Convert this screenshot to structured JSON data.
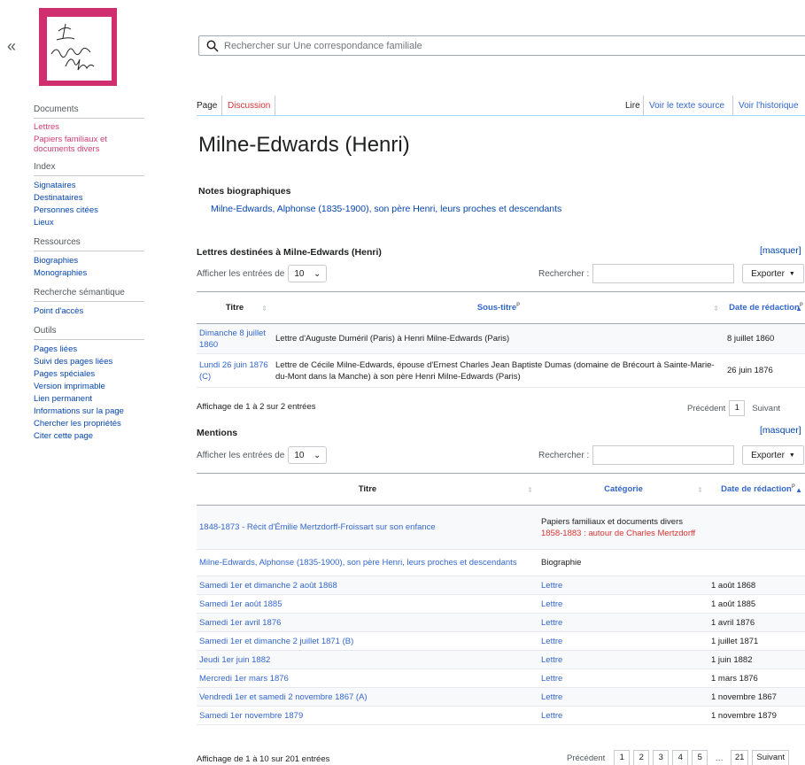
{
  "nav": {
    "collapse_glyph": "«"
  },
  "logo": {
    "alt_icon": "manuscript-logo"
  },
  "search": {
    "placeholder": "Rechercher sur Une correspondance familiale"
  },
  "sidebar": {
    "documents": {
      "heading": "Documents",
      "items": [
        "Lettres",
        "Papiers familiaux et documents divers"
      ]
    },
    "index": {
      "heading": "Index",
      "items": [
        "Signataires",
        "Destinataires",
        "Personnes citées",
        "Lieux"
      ]
    },
    "ressources": {
      "heading": "Ressources",
      "items": [
        "Biographies",
        "Monographies"
      ]
    },
    "semantique": {
      "heading": "Recherche sémantique",
      "items": [
        "Point d'accès"
      ]
    },
    "outils": {
      "heading": "Outils",
      "items": [
        "Pages liées",
        "Suivi des pages liées",
        "Pages spéciales",
        "Version imprimable",
        "Lien permanent",
        "Informations sur la page",
        "Chercher les propriétés",
        "Citer cette page"
      ]
    }
  },
  "tabs": {
    "page": "Page",
    "discussion": "Discussion",
    "lire": "Lire",
    "source": "Voir le texte source",
    "historique": "Voir l'historique"
  },
  "page": {
    "title": "Milne-Edwards (Henri)"
  },
  "notes": {
    "heading": "Notes biographiques",
    "link": "Milne-Edwards, Alphonse (1835-1900), son père Henri, leurs proches et descendants"
  },
  "letters": {
    "heading": "Lettres destinées à Milne-Edwards (Henri)",
    "masquer": "[masquer]",
    "show_label": "Afficher les entrées de",
    "show_value": "10",
    "search_label": "Rechercher :",
    "export_label": "Exporter",
    "columns": [
      "Titre",
      "Sous-titre",
      "Date de rédaction"
    ],
    "p_marker": "P",
    "rows": [
      {
        "title": "Dimanche 8 juillet 1860",
        "subtitle": "Lettre d'Auguste Duméril (Paris) à Henri Milne-Edwards (Paris)",
        "date": "8 juillet 1860"
      },
      {
        "title": "Lundi 26 juin 1876 (C)",
        "subtitle": "Lettre de Cécile Milne-Edwards, épouse d'Ernest Charles Jean Baptiste Dumas (domaine de Brécourt à Sainte-Marie-du-Mont dans la Manche) à son père Henri Milne-Edwards (Paris)",
        "date": "26 juin 1876"
      }
    ],
    "info": "Affichage de 1 à 2 sur 2 entrées",
    "prev": "Précédent",
    "next": "Suivant",
    "pages": [
      "1"
    ]
  },
  "mentions": {
    "heading": "Mentions",
    "masquer": "[masquer]",
    "show_label": "Afficher les entrées de",
    "show_value": "10",
    "search_label": "Rechercher :",
    "export_label": "Exporter",
    "columns": [
      "Titre",
      "Catégorie",
      "Date de rédaction"
    ],
    "p_marker": "P",
    "rows": [
      {
        "title": "1848-1873 - Récit d'Émilie Mertzdorff-Froissart sur son enfance",
        "category": "Papiers familiaux et documents divers",
        "category2": "1858-1883 : autour de Charles Mertzdorff",
        "date": ""
      },
      {
        "title": "Milne-Edwards, Alphonse (1835-1900), son père Henri, leurs proches et descendants",
        "category": "Biographie",
        "category2": "",
        "date": ""
      },
      {
        "title": "Samedi 1er et dimanche 2 août 1868",
        "category": "Lettre",
        "category2": "",
        "date": "1 août 1868"
      },
      {
        "title": "Samedi 1er août 1885",
        "category": "Lettre",
        "category2": "",
        "date": "1 août 1885"
      },
      {
        "title": "Samedi 1er avril 1876",
        "category": "Lettre",
        "category2": "",
        "date": "1 avril 1876"
      },
      {
        "title": "Samedi 1er et dimanche 2 juillet 1871 (B)",
        "category": "Lettre",
        "category2": "",
        "date": "1 juillet 1871"
      },
      {
        "title": "Jeudi 1er juin 1882",
        "category": "Lettre",
        "category2": "",
        "date": "1 juin 1882"
      },
      {
        "title": "Mercredi 1er mars 1876",
        "category": "Lettre",
        "category2": "",
        "date": "1 mars 1876"
      },
      {
        "title": "Vendredi 1er et samedi 2 novembre 1867 (A)",
        "category": "Lettre",
        "category2": "",
        "date": "1 novembre 1867"
      },
      {
        "title": "Samedi 1er novembre 1879",
        "category": "Lettre",
        "category2": "",
        "date": "1 novembre 1879"
      }
    ],
    "info": "Affichage de 1 à 10 sur 201 entrées",
    "prev": "Précédent",
    "next": "Suivant",
    "pages": [
      "1",
      "2",
      "3",
      "4",
      "5"
    ],
    "ellipsis": "…",
    "last_page": "21"
  }
}
